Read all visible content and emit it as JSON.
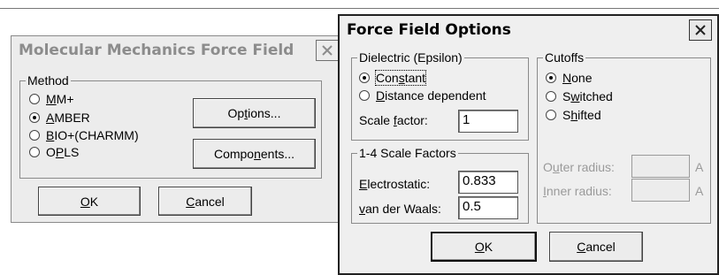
{
  "left_dialog": {
    "title": "Molecular Mechanics Force Field",
    "method_group": {
      "legend": "Method",
      "options": [
        {
          "ul": "M",
          "rest": "M+",
          "selected": false
        },
        {
          "ul": "A",
          "rest": "MBER",
          "selected": true
        },
        {
          "ul": "B",
          "rest": "IO+(CHARMM)",
          "selected": false
        },
        {
          "pre": "O",
          "ul": "P",
          "rest": "LS",
          "selected": false
        }
      ]
    },
    "options_button": {
      "pre": "Op",
      "ul": "t",
      "rest": "ions..."
    },
    "components_button": {
      "pre": "Compo",
      "ul": "n",
      "rest": "ents..."
    },
    "ok_button": {
      "ul": "O",
      "rest": "K"
    },
    "cancel_button": {
      "ul": "C",
      "rest": "ancel"
    }
  },
  "right_dialog": {
    "title": "Force Field Options",
    "dielectric_group": {
      "legend": "Dielectric (Epsilon)",
      "constant": {
        "pre": "Con",
        "ul": "s",
        "rest": "tant",
        "selected": true
      },
      "distance": {
        "ul": "D",
        "rest": "istance dependent",
        "selected": false
      },
      "scale_label": {
        "pre": "Scale ",
        "ul": "f",
        "rest": "actor:"
      },
      "scale_value": "1"
    },
    "scale_factors_group": {
      "legend": "1-4 Scale Factors",
      "electrostatic_label": {
        "ul": "E",
        "rest": "lectrostatic:"
      },
      "electrostatic_value": "0.833",
      "vdw_label": {
        "ul": "v",
        "rest": "an der Waals:"
      },
      "vdw_value": "0.5"
    },
    "cutoffs_group": {
      "legend": "Cutoffs",
      "none": {
        "ul": "N",
        "rest": "one",
        "selected": true
      },
      "switched": {
        "pre": "S",
        "ul": "w",
        "rest": "itched",
        "selected": false
      },
      "shifted": {
        "pre": "S",
        "ul": "h",
        "rest": "ifted",
        "selected": false
      },
      "outer_label": {
        "pre": "O",
        "ul": "u",
        "rest": "ter radius:"
      },
      "outer_unit": "A",
      "inner_label": {
        "ul": "I",
        "rest": "nner radius:"
      },
      "inner_unit": "A"
    },
    "ok_button": {
      "ul": "O",
      "rest": "K"
    },
    "cancel_button": {
      "ul": "C",
      "rest": "ancel"
    }
  },
  "colors": {
    "dialog_bg": "#ececec",
    "disabled_text": "#9a9a9a",
    "inactive_title": "#8c8c8c"
  },
  "icons": [
    "close-icon",
    "radio-selected",
    "radio-unselected"
  ]
}
